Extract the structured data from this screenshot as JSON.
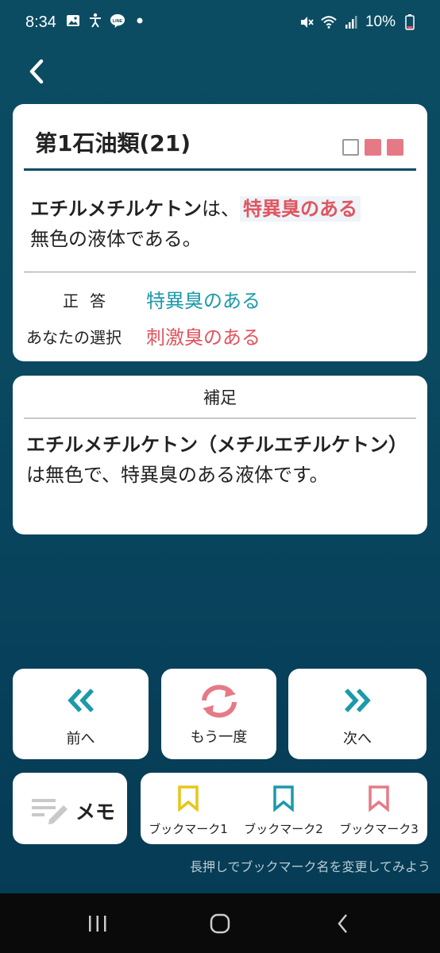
{
  "status_bar": {
    "time": "8:34",
    "battery": "10%",
    "left_icons": [
      "image-icon",
      "accessibility-icon",
      "line-icon",
      "dot-icon"
    ],
    "right_icons": [
      "mute-icon",
      "wifi-icon",
      "signal-icon",
      "battery-icon"
    ]
  },
  "header": {
    "back_icon": "chevron-left-icon"
  },
  "question": {
    "title": "第1石油類(21)",
    "progress_boxes": [
      "empty",
      "filled",
      "filled"
    ],
    "statement": {
      "term": "エチルメチルケトン",
      "particle": "は、",
      "blank": "特異臭のある",
      "rest": "無色の液体である。"
    },
    "correct_label": "正答",
    "correct_answer": "特異臭のある",
    "choice_label": "あなたの選択",
    "your_choice": "刺激臭のある"
  },
  "supplement": {
    "title": "補足",
    "term": "エチルメチルケトン（メチルエチルケトン）",
    "rest": "は無色で、特異臭のある液体です。"
  },
  "nav": {
    "prev_label": "前へ",
    "again_label": "もう一度",
    "next_label": "次へ"
  },
  "memo": {
    "label": "メモ"
  },
  "bookmarks": [
    {
      "label": "ブックマーク1",
      "color": "#e6c619"
    },
    {
      "label": "ブックマーク2",
      "color": "#1b9aaa"
    },
    {
      "label": "ブックマーク3",
      "color": "#e57a86"
    }
  ],
  "hint": "長押しでブックマーク名を変更してみよう",
  "colors": {
    "accent_teal": "#1b9aaa",
    "accent_red": "#e05560",
    "accent_pink": "#e57a86",
    "background": "#0b4c63"
  }
}
